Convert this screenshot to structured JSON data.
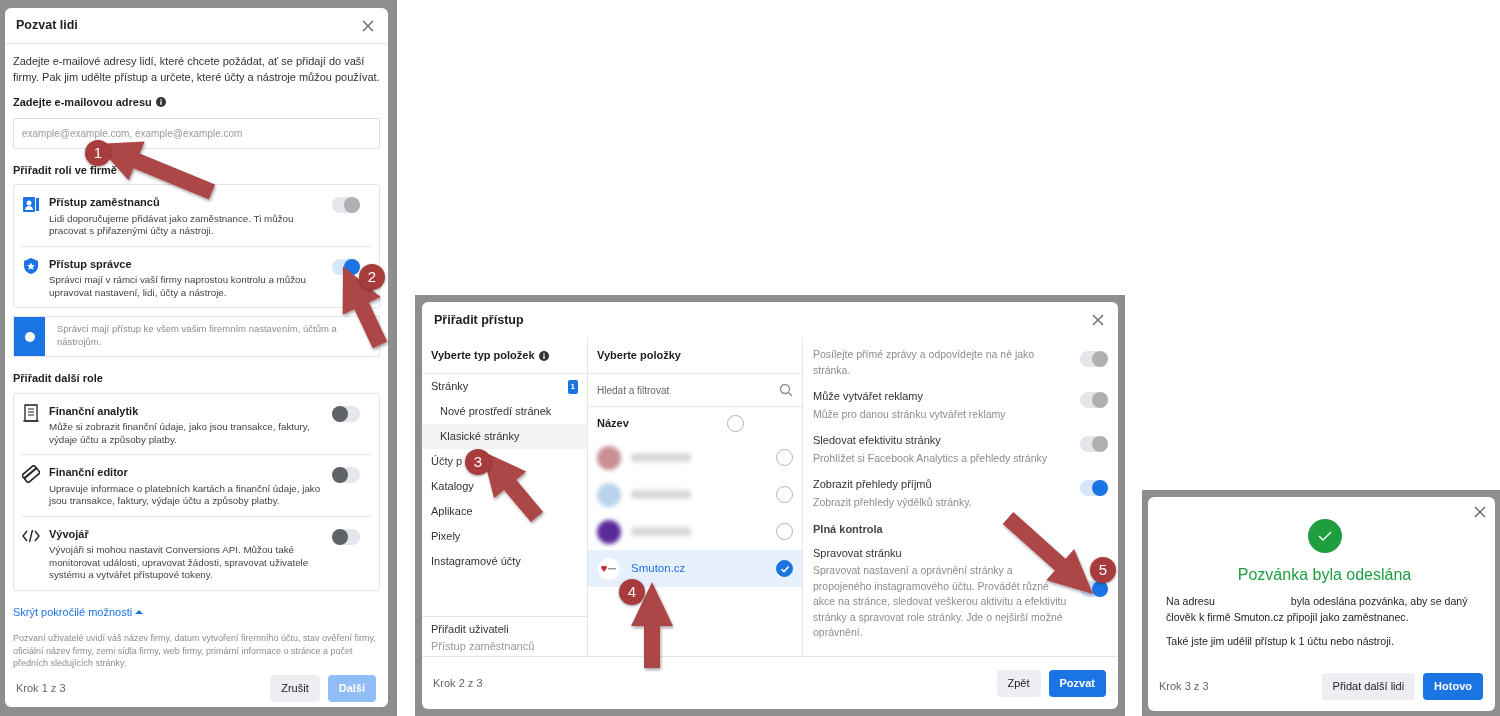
{
  "invite_dialog": {
    "title": "Pozvat lidi",
    "intro": "Zadejte e-mailové adresy lidí, které chcete požádat, ať se přidají do vaší firmy. Pak jim udělte přístup a určete, které účty a nástroje můžou používat.",
    "email_label": "Zadejte e-mailovou adresu",
    "email_field": {
      "placeholder": "example@example.com, example@example.com"
    },
    "role_heading": "Přiřadit roli ve firmě",
    "roles": [
      {
        "title": "Přístup zaměstnanců",
        "description": "Lidi doporučujeme přidávat jako zaměstnance. Ti můžou pracovat s přiřazenými účty a nástroji.",
        "on": true,
        "disabled": true
      },
      {
        "title": "Přístup správce",
        "description": "Správci mají v rámci vaší firmy naprostou kontrolu a můžou upravovat nastavení, lidi, účty a nástroje.",
        "on": true,
        "disabled": false
      }
    ],
    "admin_notice": "Správci mají přístup ke všem vašim firemním nastavením, účtům a nástrojům.",
    "other_roles_heading": "Přiřadit další role",
    "other_roles": [
      {
        "title": "Finanční analytik",
        "description": "Může si zobrazit finanční údaje, jako jsou transakce, faktury, výdaje účtu a způsoby platby.",
        "on": false,
        "disabled": false
      },
      {
        "title": "Finanční editor",
        "description": "Upravuje informace o platebních kartách a finanční údaje, jako jsou transakce, faktury, výdaje účtu a způsoby platby.",
        "on": false,
        "disabled": false
      },
      {
        "title": "Vývojář",
        "description": "Vývojáři si mohou nastavit Conversions API. Můžou také monitorovat události, upravovat žádosti, spravovat uživatele systému a vytvářet přístupové tokeny.",
        "on": false,
        "disabled": false
      }
    ],
    "advanced_link": "Skrýt pokročilé možnosti",
    "disclaimer": "Pozvaní uživatelé uvidí váš název firmy, datum vytvoření firemního účtu, stav ověření firmy, oficiální název firmy, zemi sídla firmy, web firmy, primární informace o stránce a počet předních sledujících stránky.",
    "step": "Krok 1 z 3",
    "buttons": [
      {
        "label": "Zrušit",
        "kind": "secondary",
        "disabled": false
      },
      {
        "label": "Další",
        "kind": "primary",
        "disabled": true
      }
    ]
  },
  "assign_dialog": {
    "title": "Přiřadit přístup",
    "types_heading": "Vyberte typ položek",
    "types": [
      {
        "label": "Stránky",
        "count": "1",
        "selected": false,
        "children": [
          {
            "label": "Nové prostředí stránek",
            "selected": false
          },
          {
            "label": "Klasické stránky",
            "selected": true
          }
        ]
      },
      {
        "label": "Účty p",
        "selected": false
      },
      {
        "label": "Katalogy",
        "selected": false
      },
      {
        "label": "Aplikace",
        "selected": false
      },
      {
        "label": "Pixely",
        "selected": false
      },
      {
        "label": "Instagramové účty",
        "selected": false
      }
    ],
    "assign_to_label": "Přiřadit uživateli",
    "assign_to_value": "Přístup zaměstnanců",
    "items_heading": "Vyberte položky",
    "search": {
      "placeholder": "Hledat a filtrovat"
    },
    "name_column": {
      "label": "Název",
      "checked": false
    },
    "items": [
      {
        "kind": "blurred",
        "color": "#c98f95",
        "selected": false
      },
      {
        "kind": "blurred",
        "color": "#b9d3ea",
        "selected": false
      },
      {
        "kind": "blurred",
        "color": "#5a2a9a",
        "selected": false
      },
      {
        "kind": "page",
        "name": "Smuton.cz",
        "selected": true
      }
    ],
    "permissions": [
      {
        "description": "Posílejte přímé zprávy a odpovídejte na ně jako stránka.",
        "on": true,
        "disabled": true
      },
      {
        "title": "Může vytvářet reklamy",
        "description": "Může pro danou stránku vytvářet reklamy",
        "on": true,
        "disabled": true
      },
      {
        "title": "Sledovat efektivitu stránky",
        "description": "Prohlížet si Facebook Analytics a přehledy stránky",
        "on": true,
        "disabled": true
      },
      {
        "title": "Zobrazit přehledy příjmů",
        "description": "Zobrazit přehledy výdělků stránky.",
        "on": true,
        "disabled": false
      }
    ],
    "full_control_heading": "Plná kontrola",
    "full_control": [
      {
        "title": "Spravovat stránku",
        "description": "Spravovat nastavení a oprávnění stránky a propojeného instagramového účtu. Provádět různé akce na stránce, sledovat veškerou aktivitu a efektivitu stránky a spravovat role stránky. Jde o nejširší možné oprávnění.",
        "on": true,
        "disabled": false
      }
    ],
    "step": "Krok 2 z 3",
    "buttons": [
      {
        "label": "Zpět",
        "kind": "secondary",
        "disabled": false
      },
      {
        "label": "Pozvat",
        "kind": "primary",
        "disabled": false
      }
    ]
  },
  "success_dialog": {
    "title": "Pozvánka byla odeslána",
    "message_before": "Na adresu",
    "message_after": "byla odeslána pozvánka, aby se daný člověk k firmě Smuton.cz připojil jako zaměstnanec.",
    "note": "Také jste jim udělil přístup k 1 účtu nebo nástroji.",
    "step": "Krok 3 z 3",
    "buttons": [
      {
        "label": "Přidat další lidi",
        "kind": "secondary",
        "disabled": false
      },
      {
        "label": "Hotovo",
        "kind": "primary",
        "disabled": false
      }
    ]
  },
  "annotations": [
    {
      "number": "1"
    },
    {
      "number": "2"
    },
    {
      "number": "3"
    },
    {
      "number": "4"
    },
    {
      "number": "5"
    }
  ]
}
